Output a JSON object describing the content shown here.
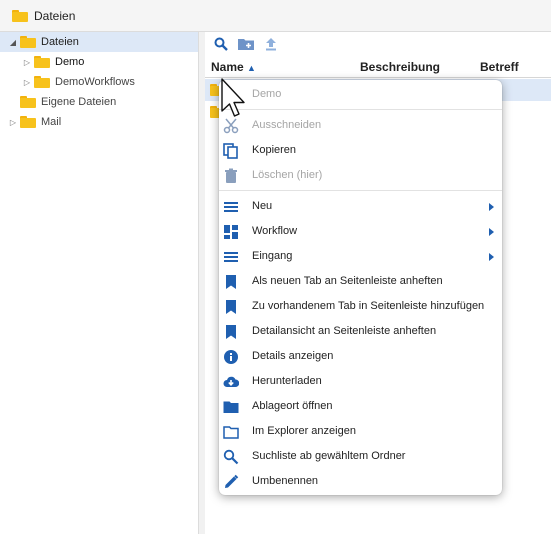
{
  "breadcrumb": {
    "label": "Dateien"
  },
  "tree": {
    "items": [
      {
        "label": "Dateien"
      },
      {
        "label": "Demo"
      },
      {
        "label": "DemoWorkflows"
      },
      {
        "label": "Eigene Dateien"
      },
      {
        "label": "Mail"
      }
    ]
  },
  "toolbar": {
    "icons": [
      "search-icon",
      "new-folder-icon",
      "upload-icon"
    ]
  },
  "table": {
    "columns": [
      "Name",
      "Beschreibung",
      "Betreff"
    ]
  },
  "menu": {
    "header": "Demo",
    "items": [
      {
        "label": "Ausschneiden",
        "icon": "scissors-icon",
        "disabled": true
      },
      {
        "label": "Kopieren",
        "icon": "copy-icon",
        "disabled": false
      },
      {
        "label": "Löschen (hier)",
        "icon": "trash-icon",
        "disabled": true
      },
      {
        "label": "Neu",
        "icon": "menu-lines-icon",
        "submenu": true
      },
      {
        "label": "Workflow",
        "icon": "dashboard-icon",
        "submenu": true
      },
      {
        "label": "Eingang",
        "icon": "menu-lines-icon",
        "submenu": true
      },
      {
        "label": "Als neuen Tab an Seitenleiste anheften",
        "icon": "bookmark-icon"
      },
      {
        "label": "Zu vorhandenem Tab in Seitenleiste hinzufügen",
        "icon": "bookmark-icon"
      },
      {
        "label": "Detailansicht an Seitenleiste anheften",
        "icon": "bookmark-icon"
      },
      {
        "label": "Details anzeigen",
        "icon": "info-icon"
      },
      {
        "label": "Herunterladen",
        "icon": "cloud-download-icon"
      },
      {
        "label": "Ablageort öffnen",
        "icon": "folder-icon"
      },
      {
        "label": "Im Explorer anzeigen",
        "icon": "folder-outline-icon"
      },
      {
        "label": "Suchliste ab gewähltem Ordner",
        "icon": "search-icon"
      },
      {
        "label": "Umbenennen",
        "icon": "pencil-icon"
      }
    ]
  },
  "colors": {
    "accent": "#1f5fb0",
    "folder": "#f7c21c",
    "selection": "#dde8f7"
  }
}
